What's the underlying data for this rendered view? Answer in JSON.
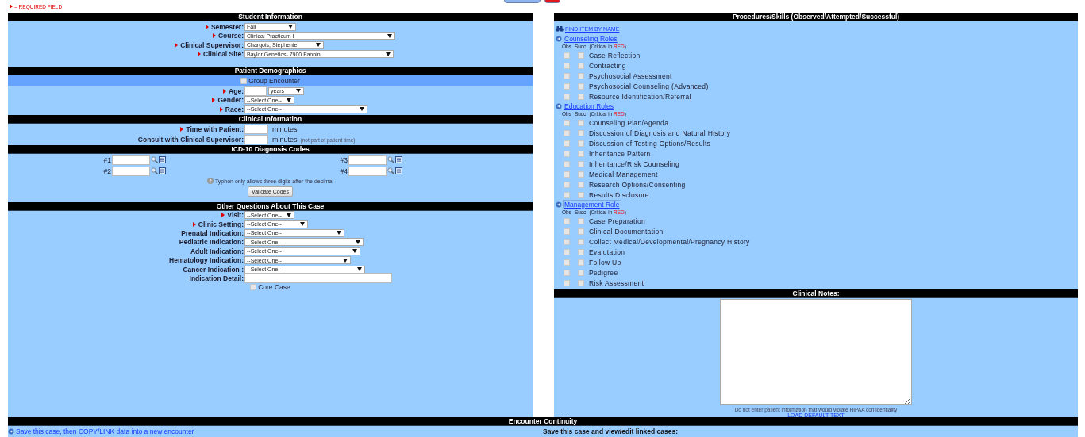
{
  "required_note": "= REQUIRED FIELD",
  "student": {
    "title": "Student Information",
    "fields": [
      {
        "label": "Semester:",
        "required": true,
        "kind": "select",
        "value": "Fall"
      },
      {
        "label": "Course:",
        "required": true,
        "kind": "select",
        "value": "Clinical Practicum I"
      },
      {
        "label": "Clinical Supervisor:",
        "required": true,
        "kind": "select",
        "value": "Chargois, Stephenie"
      },
      {
        "label": "Clinical Site:",
        "required": true,
        "kind": "select",
        "value": "Baylor Genetics- 7900 Fannin"
      }
    ]
  },
  "demographics": {
    "title": "Patient Demographics",
    "group_encounter": {
      "label": "Group Encounter",
      "checked": false
    },
    "fields": [
      {
        "label": "Age:",
        "required": true,
        "kind": "age",
        "unit": "years"
      },
      {
        "label": "Gender:",
        "required": true,
        "kind": "select",
        "value": "--Select One--"
      },
      {
        "label": "Race:",
        "required": true,
        "kind": "select",
        "value": "--Select One--"
      }
    ]
  },
  "clinical": {
    "title": "Clinical Information",
    "fields": [
      {
        "label": "Time with Patient:",
        "required": true,
        "kind": "minutes",
        "unit": "minutes"
      },
      {
        "label": "Consult with Clinical Supervisor:",
        "required": false,
        "kind": "minutes",
        "unit": "minutes",
        "note": "(not part of patient time)"
      }
    ]
  },
  "icd": {
    "title": "ICD-10 Diagnosis Codes",
    "codes": [
      "#1",
      "#3",
      "#2",
      "#4"
    ],
    "note": "Typhon only allows three digits after the decimal",
    "button": "Validate Codes"
  },
  "other": {
    "title": "Other Questions About This Case",
    "fields": [
      {
        "label": "Visit:",
        "required": true,
        "kind": "select",
        "value": "--Select One--"
      },
      {
        "label": "Clinic Setting:",
        "required": true,
        "kind": "select",
        "value": "--Select One--"
      },
      {
        "label": "Prenatal Indication:",
        "required": false,
        "kind": "select",
        "value": "--Select One--"
      },
      {
        "label": "Pediatric Indication:",
        "required": false,
        "kind": "select",
        "value": "--Select One--"
      },
      {
        "label": "Adult Indication:",
        "required": false,
        "kind": "select",
        "value": "--Select One--"
      },
      {
        "label": "Hematology Indication:",
        "required": false,
        "kind": "select",
        "value": "--Select One--"
      },
      {
        "label": "Cancer Indication :",
        "required": false,
        "kind": "select",
        "value": "--Select One--"
      },
      {
        "label": "Indication Detail:",
        "required": false,
        "kind": "text"
      }
    ],
    "core_case": {
      "label": "Core Case",
      "checked": false
    }
  },
  "procedures": {
    "title": "**Procedures/Skills** (Observed/Attempted/Successful)",
    "find_link": "FIND ITEM BY NAME",
    "groups": [
      {
        "name": "Counseling Roles",
        "focused": false,
        "obs": "Obs",
        "succ": "Succ",
        "legend_prefix": "(Critical in ",
        "legend_word": "RED",
        "legend_suffix": ")",
        "items": [
          {
            "label": "Case Reflection",
            "obs": false,
            "succ": false
          },
          {
            "label": "Contracting",
            "obs": false,
            "succ": false
          },
          {
            "label": "Psychosocial Assessment",
            "obs": false,
            "succ": false
          },
          {
            "label": "Psychosocial Counseling (Advanced)",
            "obs": false,
            "succ": false
          },
          {
            "label": "Resource Identification/Referral",
            "obs": false,
            "succ": false
          }
        ]
      },
      {
        "name": "Education Roles",
        "focused": false,
        "obs": "Obs",
        "succ": "Succ",
        "legend_prefix": "(Critical in ",
        "legend_word": "RED",
        "legend_suffix": ")",
        "items": [
          {
            "label": "Counseling Plan/Agenda",
            "obs": false,
            "succ": false
          },
          {
            "label": "Discussion of Diagnosis and Natural History",
            "obs": false,
            "succ": false
          },
          {
            "label": "Discussion of Testing Options/Results",
            "obs": false,
            "succ": false
          },
          {
            "label": "Inheritance Pattern",
            "obs": false,
            "succ": false
          },
          {
            "label": "Inheritance/Risk Counseling",
            "obs": false,
            "succ": false
          },
          {
            "label": "Medical Management",
            "obs": false,
            "succ": false
          },
          {
            "label": "Research Options/Consenting",
            "obs": false,
            "succ": false
          },
          {
            "label": "Results Disclosure",
            "obs": false,
            "succ": false
          }
        ]
      },
      {
        "name": "Management Role",
        "focused": true,
        "obs": "Obs",
        "succ": "Succ",
        "legend_prefix": "(Critical in ",
        "legend_word": "RED",
        "legend_suffix": ")",
        "items": [
          {
            "label": "Case Preparation",
            "obs": false,
            "succ": false
          },
          {
            "label": "Clinical Documentation",
            "obs": false,
            "succ": false
          },
          {
            "label": "Collect Medical/Developmental/Pregnancy History",
            "obs": false,
            "succ": false
          },
          {
            "label": "Evalutation",
            "obs": false,
            "succ": false
          },
          {
            "label": "Follow Up",
            "obs": false,
            "succ": false
          },
          {
            "label": "Pedigree",
            "obs": false,
            "succ": false
          },
          {
            "label": "Risk Assessment",
            "obs": false,
            "succ": false
          }
        ]
      }
    ]
  },
  "notes": {
    "title": "Clinical Notes:",
    "hint": "Do not enter patient information that would violate HIPAA confidentiality",
    "link": "LOAD DEFAULT TEXT"
  },
  "continuity": {
    "title": "Encounter Continuity",
    "copy_link": "Save this case, then COPY/LINK data into a new encounter",
    "linked_label": "Save this case and view/edit linked cases:"
  }
}
